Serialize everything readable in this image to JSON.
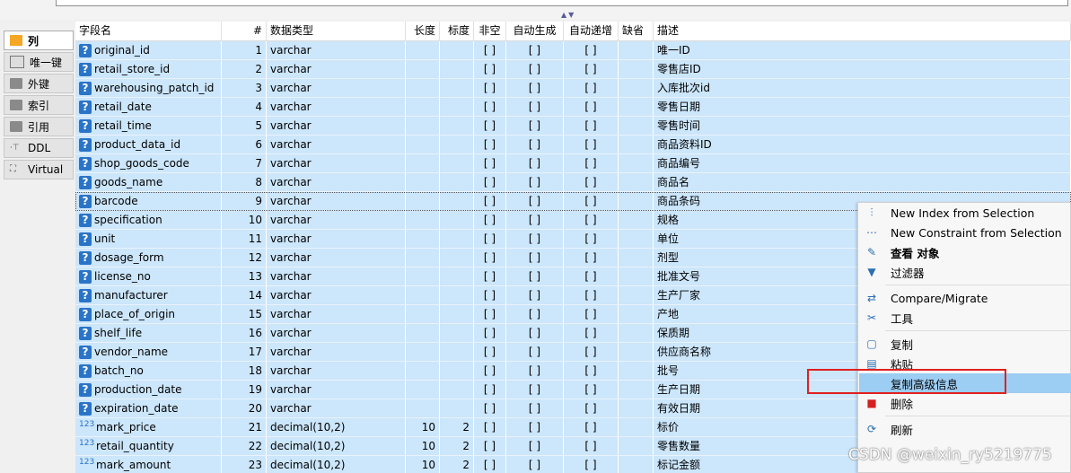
{
  "sidebar": {
    "tabs": [
      {
        "label": "列",
        "icon": "columns-icon",
        "active": true
      },
      {
        "label": "唯一键",
        "icon": "unique-key-icon",
        "active": false
      },
      {
        "label": "外键",
        "icon": "folder-icon",
        "active": false
      },
      {
        "label": "索引",
        "icon": "folder-icon",
        "active": false
      },
      {
        "label": "引用",
        "icon": "folder-icon",
        "active": false
      },
      {
        "label": "DDL",
        "icon": "ddl-icon",
        "active": false
      },
      {
        "label": "Virtual",
        "icon": "virtual-icon",
        "active": false
      }
    ]
  },
  "table": {
    "headers": [
      "字段名",
      "#",
      "数据类型",
      "长度",
      "标度",
      "非空",
      "自动生成",
      "自动递增",
      "缺省",
      "描述"
    ],
    "rows": [
      {
        "name": "original_id",
        "idx": "1",
        "type": "varchar",
        "len": "",
        "scale": "",
        "nn": "[ ]",
        "auto": "[ ]",
        "inc": "[ ]",
        "miss": "",
        "desc": "唯一ID",
        "icon": "?"
      },
      {
        "name": "retail_store_id",
        "idx": "2",
        "type": "varchar",
        "len": "",
        "scale": "",
        "nn": "[ ]",
        "auto": "[ ]",
        "inc": "[ ]",
        "miss": "",
        "desc": "零售店ID",
        "icon": "?"
      },
      {
        "name": "warehousing_patch_id",
        "idx": "3",
        "type": "varchar",
        "len": "",
        "scale": "",
        "nn": "[ ]",
        "auto": "[ ]",
        "inc": "[ ]",
        "miss": "",
        "desc": "入库批次id",
        "icon": "?"
      },
      {
        "name": "retail_date",
        "idx": "4",
        "type": "varchar",
        "len": "",
        "scale": "",
        "nn": "[ ]",
        "auto": "[ ]",
        "inc": "[ ]",
        "miss": "",
        "desc": "零售日期",
        "icon": "?"
      },
      {
        "name": "retail_time",
        "idx": "5",
        "type": "varchar",
        "len": "",
        "scale": "",
        "nn": "[ ]",
        "auto": "[ ]",
        "inc": "[ ]",
        "miss": "",
        "desc": "零售时间",
        "icon": "?"
      },
      {
        "name": "product_data_id",
        "idx": "6",
        "type": "varchar",
        "len": "",
        "scale": "",
        "nn": "[ ]",
        "auto": "[ ]",
        "inc": "[ ]",
        "miss": "",
        "desc": "商品资料ID",
        "icon": "?"
      },
      {
        "name": "shop_goods_code",
        "idx": "7",
        "type": "varchar",
        "len": "",
        "scale": "",
        "nn": "[ ]",
        "auto": "[ ]",
        "inc": "[ ]",
        "miss": "",
        "desc": "商品编号",
        "icon": "?"
      },
      {
        "name": "goods_name",
        "idx": "8",
        "type": "varchar",
        "len": "",
        "scale": "",
        "nn": "[ ]",
        "auto": "[ ]",
        "inc": "[ ]",
        "miss": "",
        "desc": "商品名",
        "icon": "?"
      },
      {
        "name": "barcode",
        "idx": "9",
        "type": "varchar",
        "len": "",
        "scale": "",
        "nn": "[ ]",
        "auto": "[ ]",
        "inc": "[ ]",
        "miss": "",
        "desc": "商品条码",
        "icon": "?",
        "focus": true
      },
      {
        "name": "specification",
        "idx": "10",
        "type": "varchar",
        "len": "",
        "scale": "",
        "nn": "[ ]",
        "auto": "[ ]",
        "inc": "[ ]",
        "miss": "",
        "desc": "规格",
        "icon": "?"
      },
      {
        "name": "unit",
        "idx": "11",
        "type": "varchar",
        "len": "",
        "scale": "",
        "nn": "[ ]",
        "auto": "[ ]",
        "inc": "[ ]",
        "miss": "",
        "desc": "单位",
        "icon": "?"
      },
      {
        "name": "dosage_form",
        "idx": "12",
        "type": "varchar",
        "len": "",
        "scale": "",
        "nn": "[ ]",
        "auto": "[ ]",
        "inc": "[ ]",
        "miss": "",
        "desc": "剂型",
        "icon": "?"
      },
      {
        "name": "license_no",
        "idx": "13",
        "type": "varchar",
        "len": "",
        "scale": "",
        "nn": "[ ]",
        "auto": "[ ]",
        "inc": "[ ]",
        "miss": "",
        "desc": "批准文号",
        "icon": "?"
      },
      {
        "name": "manufacturer",
        "idx": "14",
        "type": "varchar",
        "len": "",
        "scale": "",
        "nn": "[ ]",
        "auto": "[ ]",
        "inc": "[ ]",
        "miss": "",
        "desc": "生产厂家",
        "icon": "?"
      },
      {
        "name": "place_of_origin",
        "idx": "15",
        "type": "varchar",
        "len": "",
        "scale": "",
        "nn": "[ ]",
        "auto": "[ ]",
        "inc": "[ ]",
        "miss": "",
        "desc": "产地",
        "icon": "?"
      },
      {
        "name": "shelf_life",
        "idx": "16",
        "type": "varchar",
        "len": "",
        "scale": "",
        "nn": "[ ]",
        "auto": "[ ]",
        "inc": "[ ]",
        "miss": "",
        "desc": "保质期",
        "icon": "?"
      },
      {
        "name": "vendor_name",
        "idx": "17",
        "type": "varchar",
        "len": "",
        "scale": "",
        "nn": "[ ]",
        "auto": "[ ]",
        "inc": "[ ]",
        "miss": "",
        "desc": "供应商名称",
        "icon": "?"
      },
      {
        "name": "batch_no",
        "idx": "18",
        "type": "varchar",
        "len": "",
        "scale": "",
        "nn": "[ ]",
        "auto": "[ ]",
        "inc": "[ ]",
        "miss": "",
        "desc": "批号",
        "icon": "?"
      },
      {
        "name": "production_date",
        "idx": "19",
        "type": "varchar",
        "len": "",
        "scale": "",
        "nn": "[ ]",
        "auto": "[ ]",
        "inc": "[ ]",
        "miss": "",
        "desc": "生产日期",
        "icon": "?"
      },
      {
        "name": "expiration_date",
        "idx": "20",
        "type": "varchar",
        "len": "",
        "scale": "",
        "nn": "[ ]",
        "auto": "[ ]",
        "inc": "[ ]",
        "miss": "",
        "desc": "有效日期",
        "icon": "?"
      },
      {
        "name": "mark_price",
        "idx": "21",
        "type": "decimal(10,2)",
        "len": "10",
        "scale": "2",
        "nn": "[ ]",
        "auto": "[ ]",
        "inc": "[ ]",
        "miss": "",
        "desc": "标价",
        "icon": "123"
      },
      {
        "name": "retail_quantity",
        "idx": "22",
        "type": "decimal(10,2)",
        "len": "10",
        "scale": "2",
        "nn": "[ ]",
        "auto": "[ ]",
        "inc": "[ ]",
        "miss": "",
        "desc": "零售数量",
        "icon": "123"
      },
      {
        "name": "mark_amount",
        "idx": "23",
        "type": "decimal(10,2)",
        "len": "10",
        "scale": "2",
        "nn": "[ ]",
        "auto": "[ ]",
        "inc": "[ ]",
        "miss": "",
        "desc": "标记金额",
        "icon": "123"
      }
    ]
  },
  "context_menu": {
    "items": [
      {
        "label": "New Index from Selection",
        "icon": "new-index-icon",
        "glyph": "⫶"
      },
      {
        "label": "New Constraint from Selection",
        "icon": "new-constraint-icon",
        "glyph": "⋯"
      },
      {
        "label": "查看 对象",
        "icon": "edit-pencil-icon",
        "glyph": "✎",
        "bold": true
      },
      {
        "label": "过滤器",
        "icon": "filter-icon",
        "glyph": "▼"
      },
      {
        "label": "Compare/Migrate",
        "icon": "compare-icon",
        "glyph": "⇄"
      },
      {
        "label": "工具",
        "icon": "tools-icon",
        "glyph": "✂"
      },
      {
        "label": "复制",
        "icon": "copy-icon",
        "glyph": "▢"
      },
      {
        "label": "粘贴",
        "icon": "paste-icon",
        "glyph": "▤"
      },
      {
        "label": "复制高级信息",
        "icon": "blank-icon",
        "glyph": "",
        "highlighted": true
      },
      {
        "label": "删除",
        "icon": "delete-icon",
        "glyph": "■"
      },
      {
        "label": "刷新",
        "icon": "refresh-icon",
        "glyph": "⟳"
      }
    ]
  },
  "watermark": "CSDN @weixin_ry5219775",
  "colors": {
    "row_bg": "#cce6fb",
    "menu_highlight": "#9ccdf3",
    "annotation_red": "#e02020",
    "icon_blue": "#2a74c8"
  }
}
